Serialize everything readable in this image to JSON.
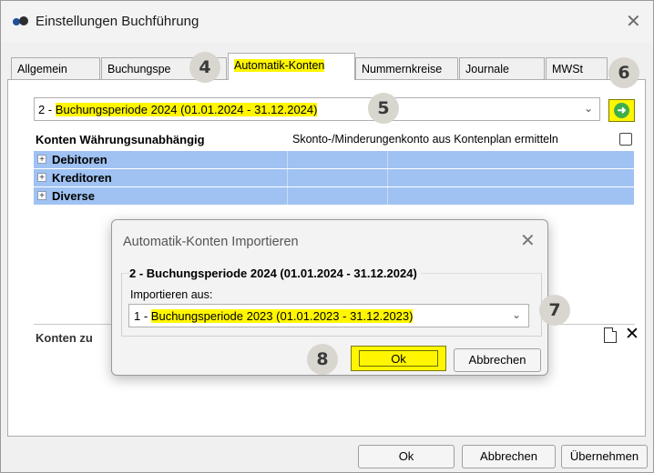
{
  "window": {
    "title": "Einstellungen Buchführung",
    "close_glyph": "✕"
  },
  "tabs": [
    {
      "label": "Allgemein"
    },
    {
      "label": "Buchungspe"
    },
    {
      "label": "Automatik-Konten"
    },
    {
      "label": "Nummernkreise"
    },
    {
      "label": "Journale"
    },
    {
      "label": "MWSt"
    }
  ],
  "badges": {
    "b4": "4",
    "b5": "5",
    "b6": "6",
    "b7": "7",
    "b8": "8"
  },
  "period_select": {
    "prefix": "2 - ",
    "value": "Buchungsperiode 2024 (01.01.2024 - 31.12.2024)",
    "chevron": "⌄"
  },
  "go_button": {
    "icon": "arrow-right-icon",
    "glyph": "➜"
  },
  "konten": {
    "header": "Konten Währungsunabhängig",
    "skonto_label": "Skonto-/Minderungenkonto aus Kontenplan ermitteln",
    "groups": [
      {
        "label": "Debitoren",
        "expander": "+"
      },
      {
        "label": "Kreditoren",
        "expander": "+"
      },
      {
        "label": "Diverse",
        "expander": "+"
      }
    ],
    "konten_zu_label": "Konten zu",
    "delete_glyph": "✕"
  },
  "buttons": {
    "ok": "Ok",
    "abbrechen": "Abbrechen",
    "uebernehmen": "Übernehmen"
  },
  "dialog": {
    "title": "Automatik-Konten Importieren",
    "close_glyph": "✕",
    "heading": "2 - Buchungsperiode 2024 (01.01.2024 - 31.12.2024)",
    "import_label": "Importieren aus:",
    "select_prefix": "1 - ",
    "select_value": "Buchungsperiode 2023 (01.01.2023 - 31.12.2023)",
    "chevron": "⌄",
    "ok": "Ok",
    "cancel": "Abbrechen"
  },
  "colors": {
    "highlight": "#fff600",
    "group_row": "#9fc2f2",
    "go_icon": "#3fae49"
  }
}
